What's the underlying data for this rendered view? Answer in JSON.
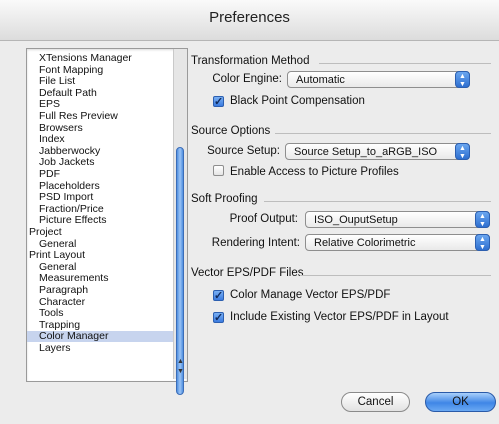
{
  "window": {
    "title": "Preferences"
  },
  "sidebar": {
    "items": [
      {
        "label": "XTensions Manager",
        "indent": 1
      },
      {
        "label": "Font Mapping",
        "indent": 1
      },
      {
        "label": "File List",
        "indent": 1
      },
      {
        "label": "Default Path",
        "indent": 1
      },
      {
        "label": "EPS",
        "indent": 1
      },
      {
        "label": "Full Res Preview",
        "indent": 1
      },
      {
        "label": "Browsers",
        "indent": 1
      },
      {
        "label": "Index",
        "indent": 1
      },
      {
        "label": "Jabberwocky",
        "indent": 1
      },
      {
        "label": "Job Jackets",
        "indent": 1
      },
      {
        "label": "PDF",
        "indent": 1
      },
      {
        "label": "Placeholders",
        "indent": 1
      },
      {
        "label": "PSD Import",
        "indent": 1
      },
      {
        "label": "Fraction/Price",
        "indent": 1
      },
      {
        "label": "Picture Effects",
        "indent": 1
      },
      {
        "label": "Project",
        "indent": 0
      },
      {
        "label": "General",
        "indent": 1
      },
      {
        "label": "Print Layout",
        "indent": 0
      },
      {
        "label": "General",
        "indent": 1
      },
      {
        "label": "Measurements",
        "indent": 1
      },
      {
        "label": "Paragraph",
        "indent": 1
      },
      {
        "label": "Character",
        "indent": 1
      },
      {
        "label": "Tools",
        "indent": 1
      },
      {
        "label": "Trapping",
        "indent": 1
      },
      {
        "label": "Color Manager",
        "indent": 1,
        "selected": true
      },
      {
        "label": "Layers",
        "indent": 1
      }
    ]
  },
  "transformation": {
    "title": "Transformation Method",
    "color_engine_label": "Color Engine:",
    "color_engine_value": "Automatic",
    "black_point_label": "Black Point Compensation",
    "black_point_checked": true
  },
  "source_options": {
    "title": "Source Options",
    "source_setup_label": "Source Setup:",
    "source_setup_value": "Source Setup_to_aRGB_ISO",
    "enable_access_label": "Enable Access to Picture Profiles",
    "enable_access_checked": false
  },
  "soft_proofing": {
    "title": "Soft Proofing",
    "proof_output_label": "Proof Output:",
    "proof_output_value": "ISO_OuputSetup",
    "rendering_intent_label": "Rendering Intent:",
    "rendering_intent_value": "Relative Colorimetric"
  },
  "vector_eps": {
    "title": "Vector EPS/PDF Files",
    "color_manage_label": "Color Manage Vector EPS/PDF",
    "color_manage_checked": true,
    "include_existing_label": "Include Existing Vector EPS/PDF in Layout",
    "include_existing_checked": true
  },
  "buttons": {
    "cancel": "Cancel",
    "ok": "OK"
  },
  "colors": {
    "accent": "#3f86e6",
    "selection": "#c7d4ee"
  }
}
